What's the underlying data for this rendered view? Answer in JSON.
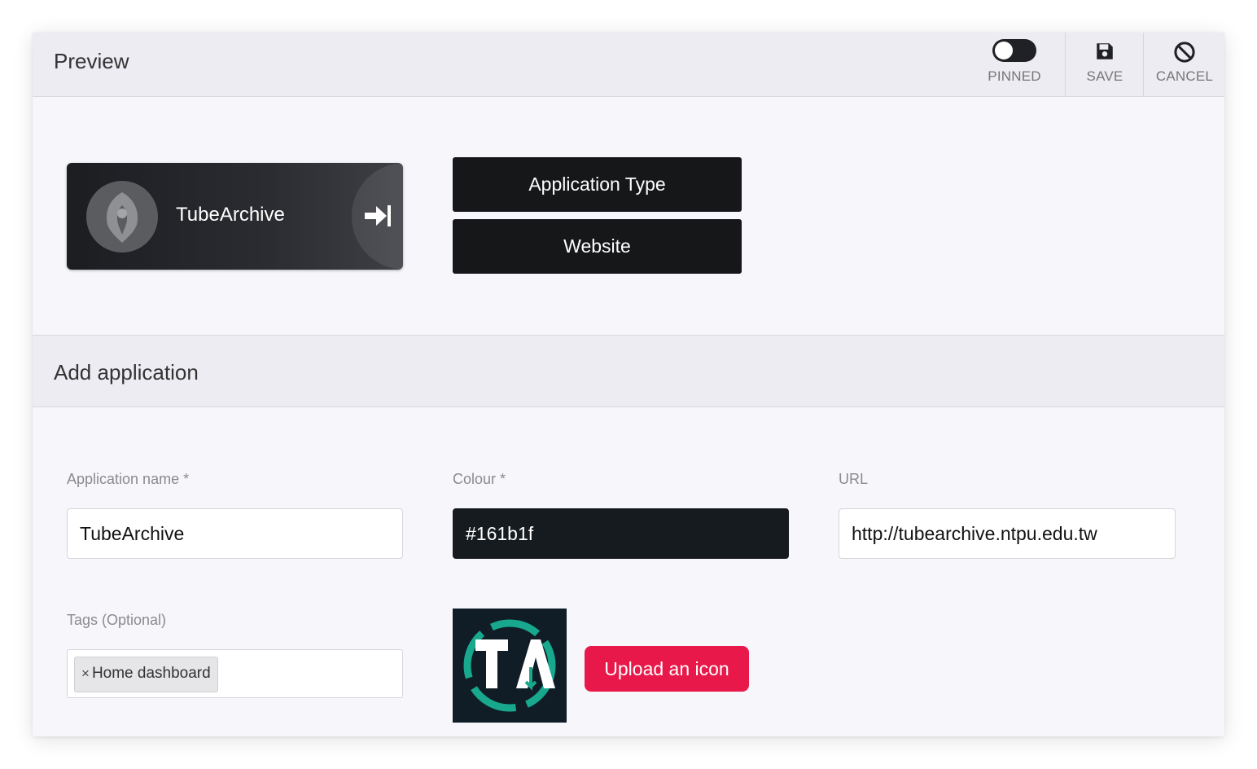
{
  "header": {
    "title": "Preview",
    "actions": {
      "pinned_label": "PINNED",
      "save_label": "SAVE",
      "cancel_label": "CANCEL"
    },
    "pinned_on": false
  },
  "preview": {
    "tile_name": "TubeArchive",
    "tile_color": "#161b1f",
    "type_button": "Application Type",
    "website_button": "Website"
  },
  "section": {
    "title": "Add application"
  },
  "form": {
    "name_label": "Application name *",
    "name_value": "TubeArchive",
    "colour_label": "Colour *",
    "colour_value": "#161b1f",
    "url_label": "URL",
    "url_value": "http://tubearchive.ntpu.edu.tw",
    "tags_label": "Tags (Optional)",
    "tags": [
      "Home dashboard"
    ],
    "upload_label": "Upload an icon"
  },
  "colors": {
    "accent_upload": "#e8194a",
    "dark_tile": "#161b1f",
    "icon_teal": "#17a88e"
  }
}
